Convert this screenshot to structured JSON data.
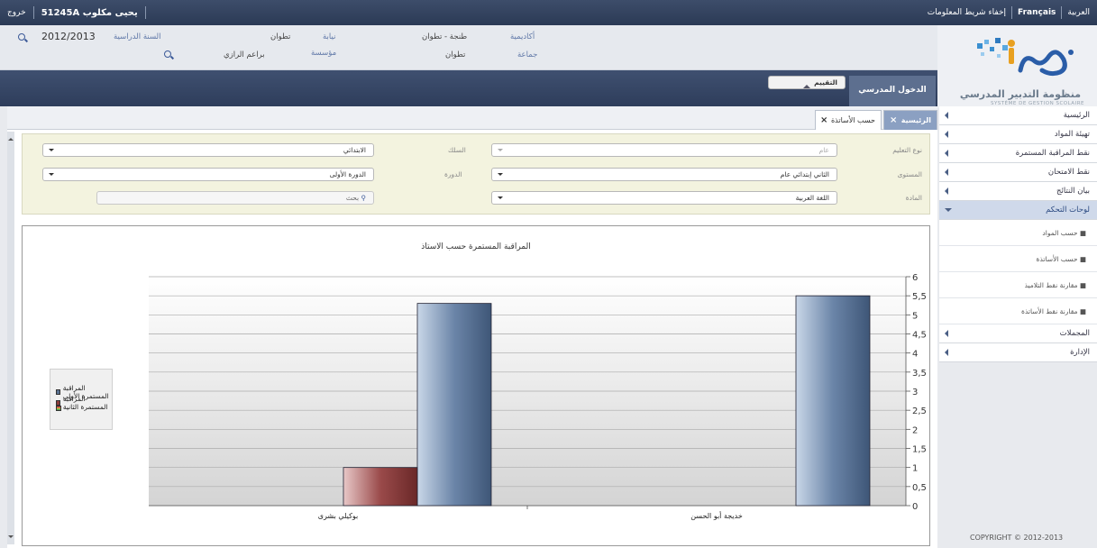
{
  "topbar": {
    "logout": "خروج",
    "user": "51245A يحيى مكلوب",
    "lang_ar": "العربية",
    "lang_fr": "Français",
    "hide_info": "إخفاء شريط المعلومات"
  },
  "header": {
    "academy_k": "أكاديمية",
    "academy_v": "طنجة - تطوان",
    "delegation_k": "نيابة",
    "delegation_v": "تطوان",
    "year_k": "السنة الدراسية",
    "year_v": "2012/2013",
    "commune_k": "جماعة",
    "commune_v": "تطوان",
    "institution_k": "مؤسسة",
    "institution_v": "براعم الرازي"
  },
  "logo": {
    "brand": "مسار",
    "subtitle_ar": "منظومة التدبير المدرسي",
    "subtitle_fr": "SYSTÈME DE GESTION SCOLAIRE"
  },
  "nav": {
    "tab1": "الدخول المدرسي",
    "tab2": "التقييم"
  },
  "menu": {
    "items": [
      "الرئيسية",
      "تهيئة المواد",
      "نقط المراقبة المستمرة",
      "نقط الامتحان",
      "بيان النتائج",
      "لوحات التحكم",
      "المجملات",
      "الإدارة"
    ],
    "subitems": [
      "حسب المواد",
      "حسب الأساتذة",
      "مقارنة نقط التلاميذ",
      "مقارنة نقط الأساتذة"
    ]
  },
  "copyright": "COPYRIGHT © 2012-2013",
  "tabs": {
    "home": "الرئيسية",
    "by_teacher": "حسب الأساتذة"
  },
  "filters": {
    "type_k": "نوع التعليم",
    "type_v": "عام",
    "cycle_k": "السلك",
    "cycle_v": "الابتدائي",
    "level_k": "المستوى",
    "level_v": "الثاني إبتدائي عام",
    "period_k": "الدورة",
    "period_v": "الدورة الأولى",
    "subject_k": "المادة",
    "subject_v": "اللغة العربية",
    "search_placeholder": "بحث"
  },
  "chart_data": {
    "type": "bar",
    "title": "المراقبة المستمرة حسب الاستاذ",
    "categories": [
      "خديجة أبو الحسن",
      "بوكيلي بشرى"
    ],
    "series": [
      {
        "name": "المراقبة المستمرة الأولى",
        "values": [
          5.5,
          5.3
        ],
        "color": "#5b7393"
      },
      {
        "name": "المراقبة المستمرة الثانية",
        "values": [
          0,
          1
        ],
        "color": "#8b3c3c"
      }
    ],
    "ylim": [
      0,
      6
    ],
    "yticks": [
      "0",
      "0,5",
      "1",
      "1,5",
      "2",
      "2,5",
      "3",
      "3,5",
      "4",
      "4,5",
      "5",
      "5,5",
      "6"
    ],
    "grid": true,
    "legend": "left"
  }
}
